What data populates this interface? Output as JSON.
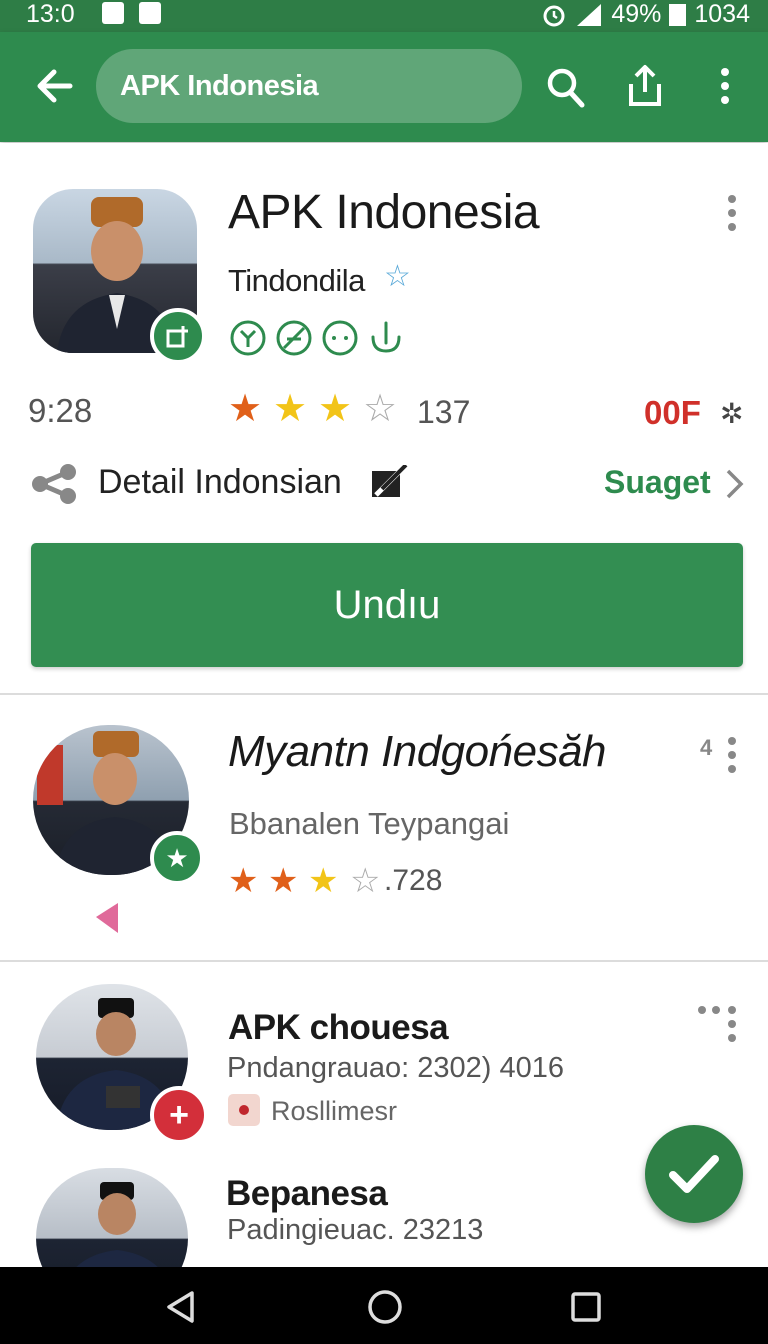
{
  "status_bar": {
    "time": "13:0",
    "battery": "49%",
    "extra": "1034"
  },
  "app_bar": {
    "search_text": "APK Indonesia"
  },
  "featured": {
    "title": "APK Indonesia",
    "subtitle": "Tindondila",
    "time": "9:28",
    "rating_count": "137",
    "price_tag": "00F",
    "detail_label": "Detail Indonsian",
    "suggest_label": "Suaget",
    "cta_label": "Undıu"
  },
  "list": [
    {
      "title": "Myantn Indgońesăh",
      "subtitle": "Bbanalen Teypangai",
      "rating_count": ".728",
      "corner": "4"
    },
    {
      "title": "APK chouesa",
      "subtitle": "Pndangrauao: 2302) 4016",
      "tag": "Rosllimesr"
    },
    {
      "title": "Bepanesa",
      "subtitle": "Padingieuac. 23213"
    }
  ],
  "colors": {
    "primary": "#2e8b4e",
    "status_bar": "#2e7d46",
    "cta": "#338e52",
    "price_red": "#d0302a",
    "star_orange": "#e0601a",
    "star_yellow": "#f2c418"
  },
  "icons": [
    "back-arrow-icon",
    "search-icon",
    "share-icon",
    "more-vert-icon",
    "badge-plus-icon",
    "star-outline-icon",
    "leaf-icon",
    "no-leaf-icon",
    "face-icon",
    "hand-icon",
    "settings-cog-icon",
    "share-nodes-icon",
    "edit-icon",
    "chevron-right-icon",
    "star-badge-icon",
    "heart-icon",
    "red-plus-icon",
    "check-icon",
    "nav-back-icon",
    "nav-home-icon",
    "nav-recents-icon"
  ]
}
